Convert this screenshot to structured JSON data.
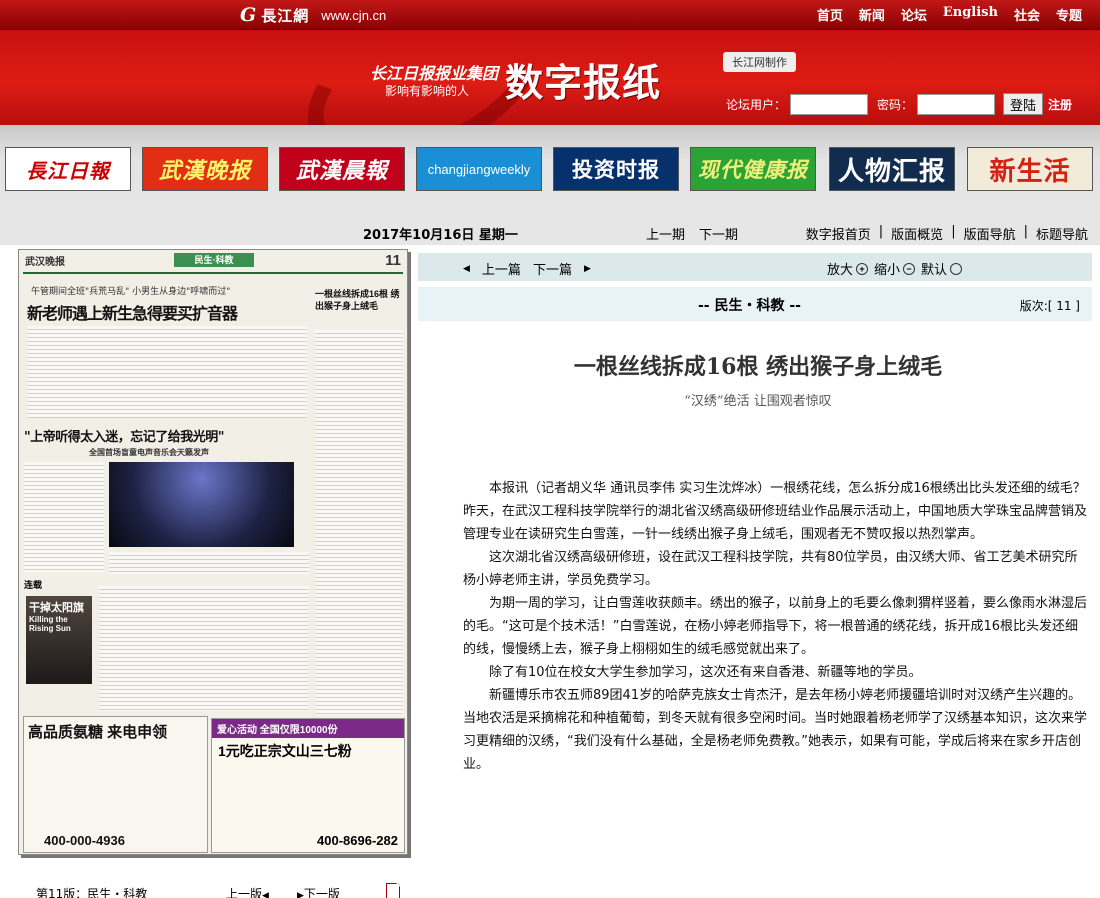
{
  "site": {
    "logo_glyph": "G",
    "name_cn": "長江網",
    "url": "www.cjn.cn"
  },
  "topnav": [
    "首页",
    "新闻",
    "论坛",
    "English",
    "社会",
    "专题"
  ],
  "banner": {
    "group": "长江日报报业集团",
    "slogan": "影响有影响的人",
    "title": "数字报纸",
    "made_by": "长江网制作"
  },
  "login": {
    "user_label": "论坛用户：",
    "password_label": "密码：",
    "button": "登陆",
    "register": "注册"
  },
  "papers": [
    "長江日報",
    "武漢晚报",
    "武漢晨報",
    "changjiangweekly",
    "投资时报",
    "现代健康报",
    "人物汇报",
    "新生活"
  ],
  "datebar": {
    "date": "2017年10月16日  星期一",
    "prev_issue": "上一期",
    "next_issue": "下一期",
    "nav": [
      "数字报首页",
      "版面概览",
      "版面导航",
      "标题导航"
    ],
    "sep": "|"
  },
  "thumbnail": {
    "masthead": "武汉晚报",
    "section": "民生·科教",
    "page_no": "11",
    "kicker": "午管期间全班\"兵荒马乱\"  小男生从身边\"呼啸而过\"",
    "headline_1": "新老师遇上新生急得要买扩音器",
    "right_head": "一根丝线拆成16根 绣出猴子身上绒毛",
    "headline_2": "\"上帝听得太入迷，忘记了给我光明\"",
    "headline_2_sub": "全国首场盲童电声音乐会天籁发声",
    "serial": "连载",
    "book_title": "干掉太阳旗",
    "book_sub": "Killing the Rising Sun",
    "ad_left_title": "高品质氨糖 来电申领",
    "ad_left_phone": "400-000-4936",
    "ad_right_band": "爱心活动 全国仅限10000份",
    "ad_right_title": "1元吃正宗文山三七粉",
    "ad_right_phone": "400-8696-282"
  },
  "footer_left": {
    "current": "第11版：民生・科教",
    "prev_page": "上一版",
    "next_page": "下一版"
  },
  "toolbar": {
    "prev_article": "上一篇",
    "next_article": "下一篇",
    "zoom_in": "放大",
    "zoom_out": "缩小",
    "default": "默认"
  },
  "section_bar": {
    "section": "-- 民生・科教 --",
    "page_label": "版次:[ 11 ]"
  },
  "article": {
    "headline": "一根丝线拆成16根  绣出猴子身上绒毛",
    "subheadline": "“汉绣”绝活  让围观者惊叹",
    "paragraphs": [
      "本报讯（记者胡义华 通讯员李伟 实习生沈烨冰）一根绣花线，怎么拆分成16根绣出比头发还细的绒毛？昨天，在武汉工程科技学院举行的湖北省汉绣高级研修班结业作品展示活动上，中国地质大学珠宝品牌营销及管理专业在读研究生白雪莲，一针一线绣出猴子身上绒毛，围观者无不赞叹报以热烈掌声。",
      "这次湖北省汉绣高级研修班，设在武汉工程科技学院，共有80位学员，由汉绣大师、省工艺美术研究所杨小婷老师主讲，学员免费学习。",
      "为期一周的学习，让白雪莲收获颇丰。绣出的猴子，以前身上的毛要么像刺猬样竖着，要么像雨水淋湿后的毛。“这可是个技术活！”白雪莲说，在杨小婷老师指导下，将一根普通的绣花线，拆开成16根比头发还细的线，慢慢绣上去，猴子身上栩栩如生的绒毛感觉就出来了。",
      "除了有10位在校女大学生参加学习，这次还有来自香港、新疆等地的学员。",
      "新疆博乐市农五师89团41岁的哈萨克族女士肯杰汗，是去年杨小婷老师援疆培训时对汉绣产生兴趣的。当地农活是采摘棉花和种植葡萄，到冬天就有很多空闲时间。当时她跟着杨老师学了汉绣基本知识，这次来学习更精细的汉绣，“我们没有什么基础，全是杨老师免费教。”她表示，如果有可能，学成后将来在家乡开店创业。"
    ]
  },
  "colors": {
    "banner_red": "#d81a12",
    "toolbar_bg": "#dce9ea",
    "section_bg": "#e9f2f4"
  }
}
